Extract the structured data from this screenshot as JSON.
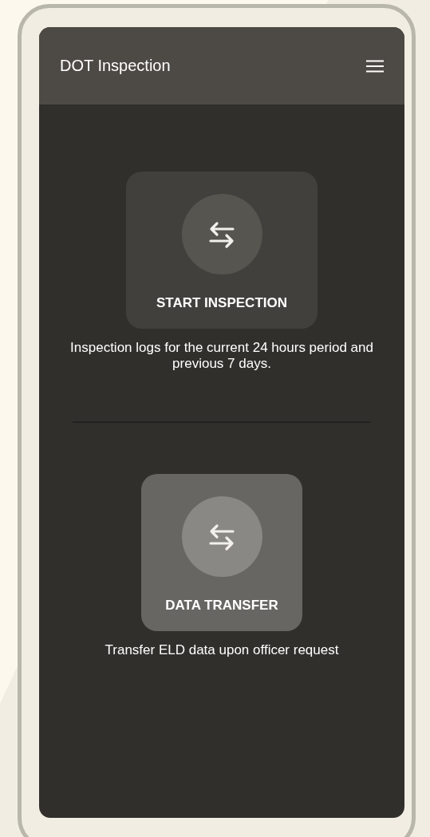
{
  "app_bar": {
    "title": "DOT Inspection"
  },
  "options": [
    {
      "label": "START INSPECTION",
      "description": "Inspection logs for the current 24 hours period and previous 7 days.",
      "selected": false
    },
    {
      "label": "DATA TRANSFER",
      "description": "Transfer ELD data upon officer request",
      "selected": true
    }
  ]
}
